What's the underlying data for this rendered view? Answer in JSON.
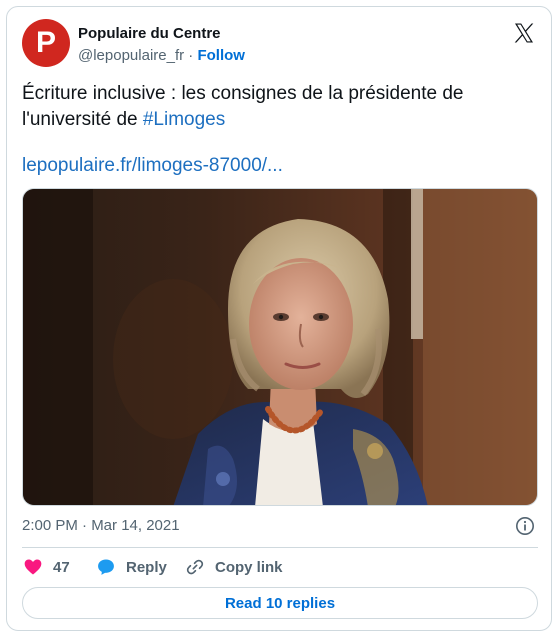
{
  "author": {
    "name": "Populaire du Centre",
    "handle": "@lepopulaire_fr",
    "separator": "·",
    "follow_label": "Follow",
    "avatar_letter": "P",
    "avatar_color": "#d0271f"
  },
  "tweet": {
    "text_main": "Écriture inclusive : les consignes de la présidente de l'université de ",
    "hashtag": "#Limoges",
    "link": "lepopulaire.fr/limoges-87000/..."
  },
  "meta": {
    "timestamp": "2:00 PM · Mar 14, 2021"
  },
  "actions": {
    "like_count": "47",
    "reply_label": "Reply",
    "copy_link_label": "Copy link"
  },
  "footer": {
    "read_replies_label": "Read 10 replies"
  },
  "colors": {
    "link_blue": "#1d6fc0",
    "like_pink": "#f91880",
    "reply_blue": "#1d9bf0"
  }
}
